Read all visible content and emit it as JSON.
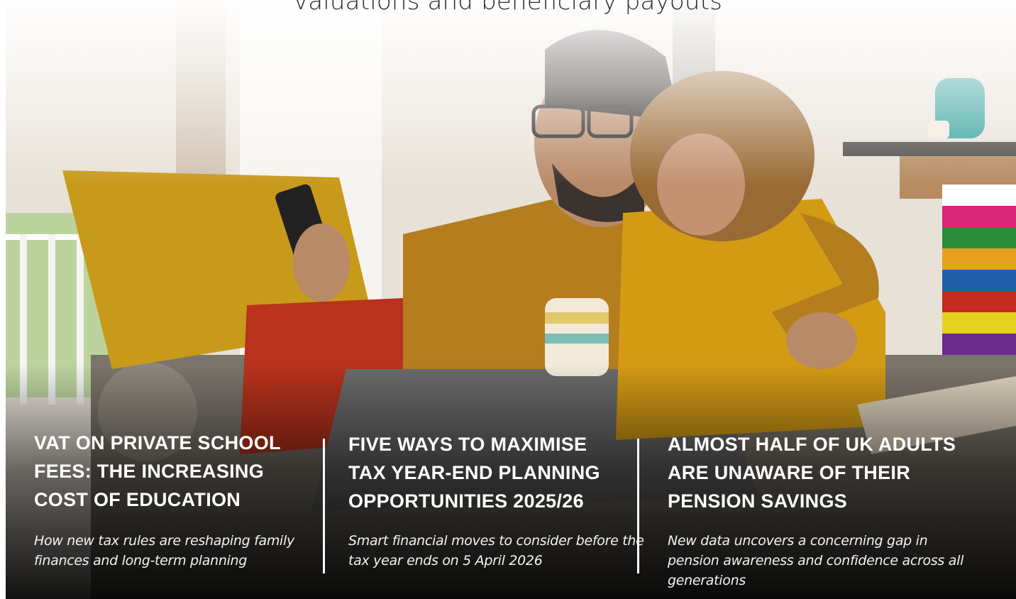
{
  "header": {
    "subtitle_fragment": "valuations and beneficiary payouts"
  },
  "articles": [
    {
      "title": "VAT ON PRIVATE SCHOOL FEES: THE INCREASING COST OF EDUCATION",
      "summary": "How new tax rules are reshaping family finances and long-term planning"
    },
    {
      "title": "FIVE WAYS TO MAXIMISE TAX YEAR-END PLANNING OPPORTUNITIES 2025/26",
      "summary": "Smart financial moves to consider before the tax year ends on 5 April 2026"
    },
    {
      "title": "ALMOST HALF OF UK ADULTS ARE UNAWARE OF THEIR PENSION SAVINGS",
      "summary": "New data uncovers a concerning gap in pension awareness and confidence across all generations"
    }
  ],
  "colors": {
    "mustard": "#c79a1c",
    "red_cushion": "#b8321c",
    "shirt": "#b47e1e",
    "hoodie": "#d39a14",
    "text_light": "#ffffff",
    "subtitle": "#2b2b2b"
  }
}
